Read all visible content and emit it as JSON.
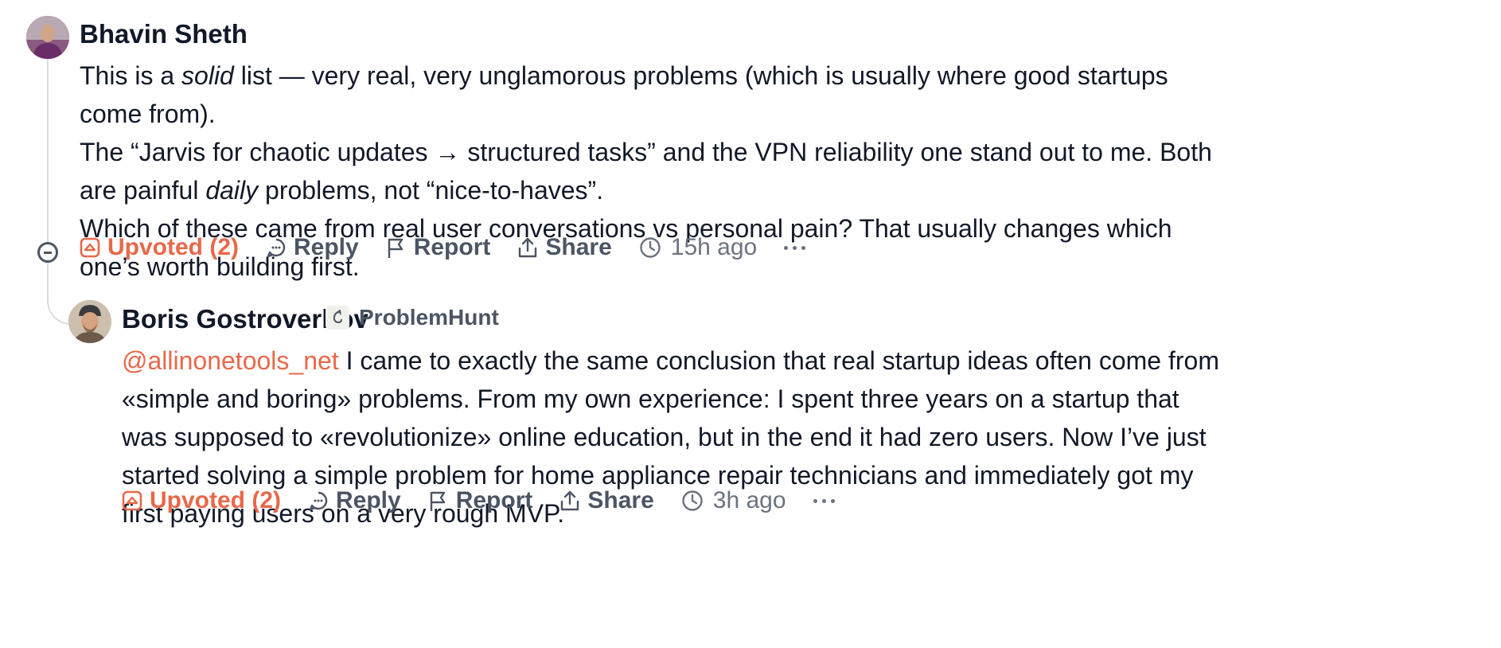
{
  "comment1": {
    "author": "Bhavin Sheth",
    "paragraphs": [
      [
        "This is a ",
        "solid",
        " list — very real, very unglamorous problems (which is usually where good startups come from)."
      ],
      [
        "The “Jarvis for chaotic updates → structured tasks” and the VPN reliability one stand out to me. Both are painful ",
        "daily",
        " problems, not “nice-to-haves”."
      ],
      [
        "Which of these came from real user conversations vs personal pain? That usually changes which one’s worth building first."
      ]
    ],
    "actions": {
      "upvoted": "Upvoted (2)",
      "reply": "Reply",
      "report": "Report",
      "share": "Share",
      "time": "15h ago"
    }
  },
  "comment2": {
    "author": "Boris Gostroverhov",
    "badge": "ProblemHunt",
    "mention": "@allinonetools_net",
    "text": " I came to exactly the same conclusion that real startup ideas often come from «simple and boring» problems. From my own experience: I spent three years on a startup that was supposed to «revolution­ize» online education, but in the end it had zero users. Now I’ve just started solving a simple problem for home ap­pliance repair technicians and immediately got my first paying users on a very rough MVP.",
    "actions": {
      "upvoted": "Upvoted (2)",
      "reply": "Reply",
      "report": "Report",
      "share": "Share",
      "time": "3h ago"
    }
  },
  "colors": {
    "accent": "#e8684a",
    "muted": "#4b5563",
    "thread_line": "#d9dce1"
  },
  "icons": [
    "upvote-icon",
    "reply-icon",
    "flag-icon",
    "share-icon",
    "clock-icon",
    "more-icon",
    "collapse-icon",
    "problemhunt-logo-icon"
  ]
}
